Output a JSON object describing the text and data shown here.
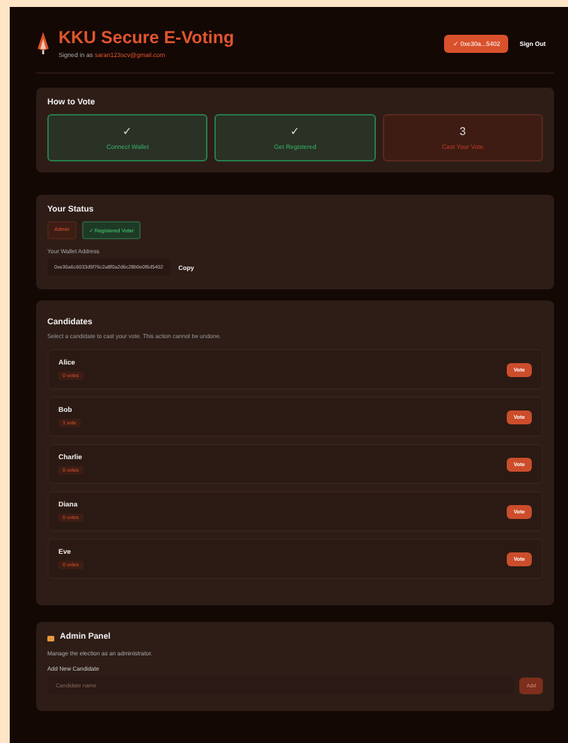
{
  "header": {
    "title": "KKU Secure E-Voting",
    "signed_in_label": "Signed in as",
    "email": "saran123scv@gmail.com",
    "wallet_button": "✓ 0xe30a...5402",
    "sign_out": "Sign Out"
  },
  "how_to_vote": {
    "title": "How to Vote",
    "steps": [
      {
        "mark": "✓",
        "label": "Connect Wallet",
        "done": true
      },
      {
        "mark": "✓",
        "label": "Get Registered",
        "done": true
      },
      {
        "mark": "3",
        "label": "Cast Your Vote",
        "done": false
      }
    ]
  },
  "status": {
    "title": "Your Status",
    "badges": [
      {
        "kind": "admin",
        "label": "Admin"
      },
      {
        "kind": "voter",
        "label": "✓ Registered Voter"
      }
    ],
    "address_label": "Your Wallet Address",
    "address": "0xe30a6c6033d5f76c2a8f0a2d6c28b0e0f6d5402",
    "copy": "Copy"
  },
  "candidates": {
    "title": "Candidates",
    "hint": "Select a candidate to cast your vote. This action cannot be undone.",
    "items": [
      {
        "name": "Alice",
        "votes": "0 votes",
        "button": "Vote"
      },
      {
        "name": "Bob",
        "votes": "1 vote",
        "button": "Vote"
      },
      {
        "name": "Charlie",
        "votes": "0 votes",
        "button": "Vote"
      },
      {
        "name": "Diana",
        "votes": "0 votes",
        "button": "Vote"
      },
      {
        "name": "Eve",
        "votes": "0 votes",
        "button": "Vote"
      }
    ]
  },
  "admin": {
    "title": "Admin Panel",
    "description": "Manage the election as an administrator.",
    "field_label": "Add New Candidate",
    "placeholder": "Candidate name",
    "button": "Add"
  }
}
